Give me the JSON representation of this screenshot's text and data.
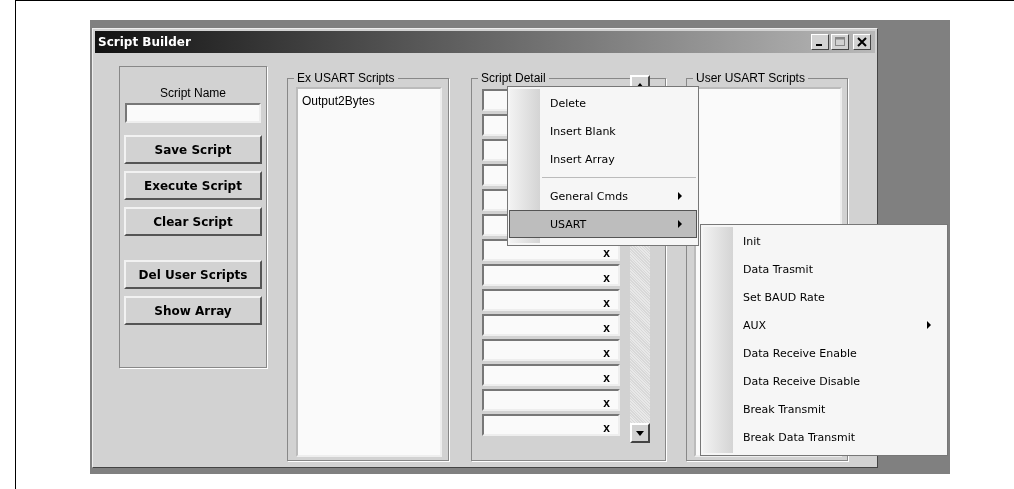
{
  "window": {
    "title": "Script Builder"
  },
  "script_panel": {
    "label": "Script Name",
    "buttons": [
      {
        "label": "Save Script",
        "gap_before": false
      },
      {
        "label": "Execute Script",
        "gap_before": false
      },
      {
        "label": "Clear Script",
        "gap_before": false
      },
      {
        "label": "Del User Scripts",
        "gap_before": true
      },
      {
        "label": "Show Array",
        "gap_before": false
      }
    ]
  },
  "ex_scripts": {
    "title": "Ex USART Scripts",
    "items": [
      "Output2Bytes"
    ]
  },
  "script_detail": {
    "title": "Script Detail",
    "rows": [
      {},
      {},
      {},
      {},
      {},
      {},
      {
        "mark": "x"
      },
      {
        "mark": "x"
      },
      {
        "mark": "x"
      },
      {
        "mark": "x"
      },
      {
        "mark": "x"
      },
      {
        "mark": "x"
      },
      {
        "mark": "x"
      },
      {
        "mark": "x"
      }
    ]
  },
  "user_scripts": {
    "title": "User USART Scripts"
  },
  "context_menu": {
    "items": [
      {
        "kind": "item",
        "label": "Delete",
        "submenu": false,
        "selected": false
      },
      {
        "kind": "item",
        "label": "Insert Blank",
        "submenu": false,
        "selected": false
      },
      {
        "kind": "item",
        "label": "Insert Array",
        "submenu": false,
        "selected": false
      },
      {
        "kind": "separator"
      },
      {
        "kind": "item",
        "label": "General Cmds",
        "submenu": true,
        "selected": false
      },
      {
        "kind": "item",
        "label": "USART",
        "submenu": true,
        "selected": true
      }
    ]
  },
  "submenu": {
    "items": [
      {
        "kind": "item",
        "label": "Init",
        "submenu": false,
        "selected": false
      },
      {
        "kind": "item",
        "label": "Data Trasmit",
        "submenu": false,
        "selected": false
      },
      {
        "kind": "item",
        "label": "Set BAUD Rate",
        "submenu": false,
        "selected": false
      },
      {
        "kind": "item",
        "label": "AUX",
        "submenu": true,
        "selected": false
      },
      {
        "kind": "item",
        "label": "Data Receive Enable",
        "submenu": false,
        "selected": false
      },
      {
        "kind": "item",
        "label": "Data Receive Disable",
        "submenu": false,
        "selected": false
      },
      {
        "kind": "item",
        "label": "Break Transmit",
        "submenu": false,
        "selected": false
      },
      {
        "kind": "item",
        "label": "Break Data Transmit",
        "submenu": false,
        "selected": false
      }
    ]
  }
}
